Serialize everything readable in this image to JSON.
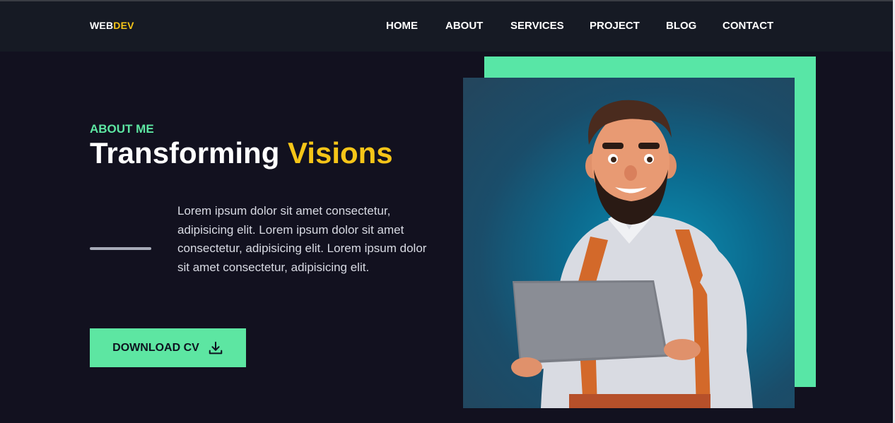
{
  "logo": {
    "prefix": "WEB",
    "accent": "DEV"
  },
  "nav": {
    "items": [
      {
        "label": "HOME"
      },
      {
        "label": "ABOUT"
      },
      {
        "label": "SERVICES"
      },
      {
        "label": "PROJECT"
      },
      {
        "label": "BLOG"
      },
      {
        "label": "CONTACT"
      }
    ]
  },
  "hero": {
    "eyebrow": "ABOUT ME",
    "title_main": "Transforming",
    "title_accent": "Visions",
    "body": "Lorem ipsum dolor sit amet consectetur, adipisicing elit. Lorem ipsum dolor sit amet consectetur, adipisicing elit. Lorem ipsum dolor sit amet consectetur, adipisicing elit.",
    "cta_label": "DOWNLOAD CV",
    "cta_icon": "download-icon"
  },
  "image": {
    "subject": "avatar-illustration"
  },
  "colors": {
    "background": "#12111f",
    "header": "#161a24",
    "accent_green": "#5de6a2",
    "accent_yellow": "#f5c518"
  }
}
